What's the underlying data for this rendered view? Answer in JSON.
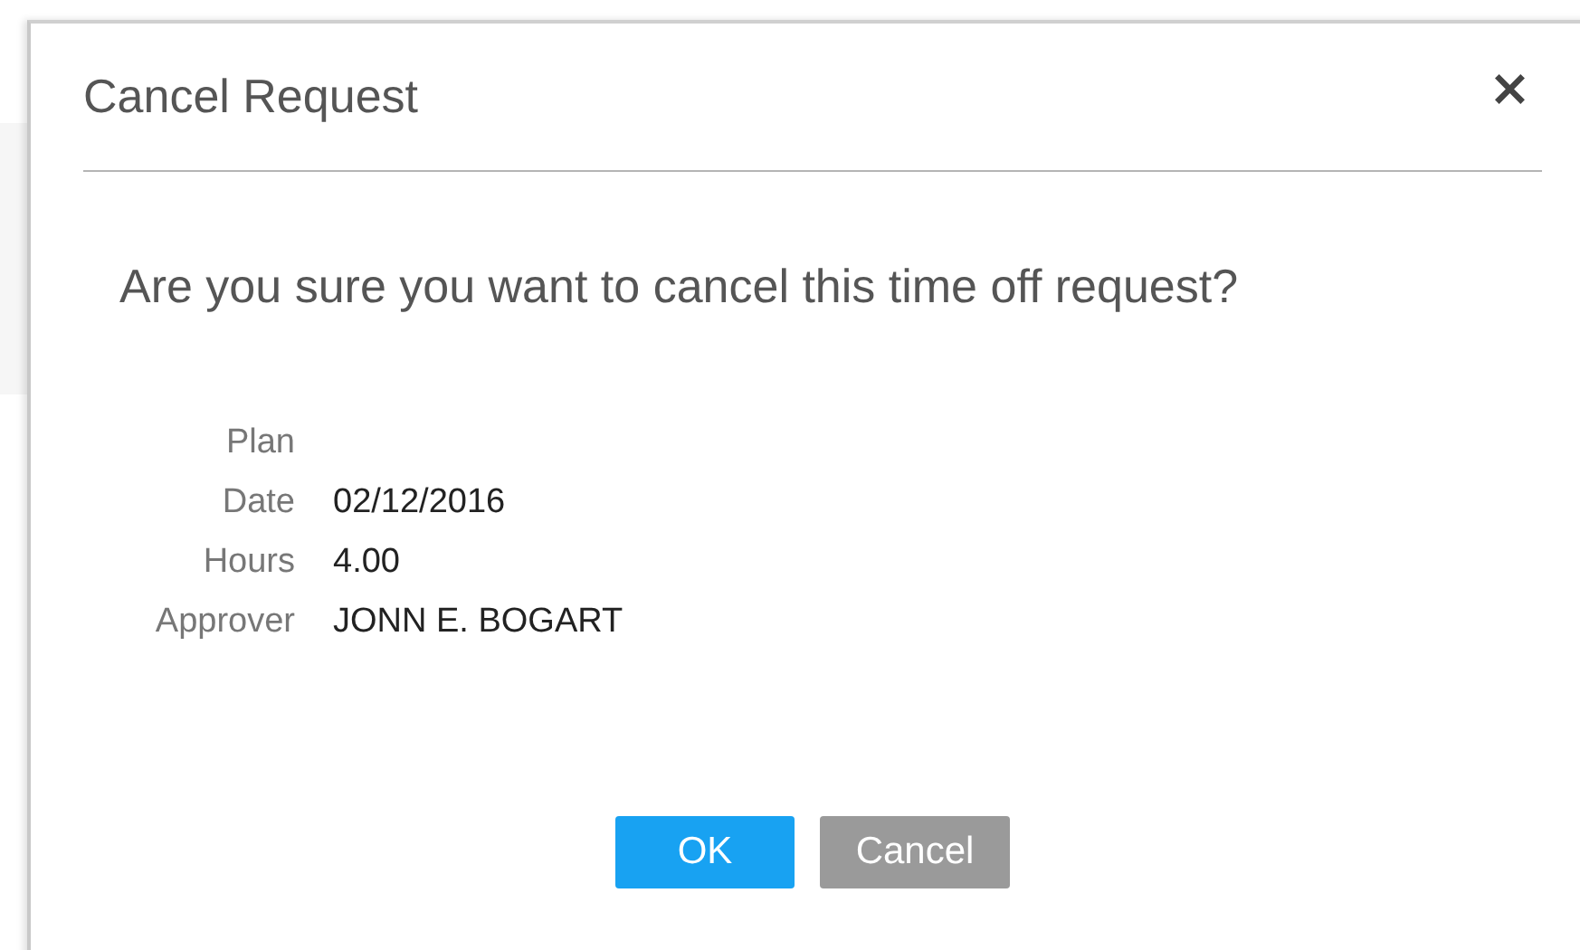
{
  "dialog": {
    "title": "Cancel Request",
    "close": "×",
    "question": "Are you sure you want to cancel this time off request?",
    "fields": [
      {
        "label": "Plan"
      },
      {
        "label": "Date",
        "value": "02/12/2016"
      },
      {
        "label": "Hours",
        "value": "4.00"
      },
      {
        "label": "Approver",
        "value": "JONN E. BOGART"
      }
    ],
    "buttons": [
      {
        "label": "OK",
        "kind": "primary"
      },
      {
        "label": "Cancel",
        "kind": "secondary"
      }
    ]
  }
}
